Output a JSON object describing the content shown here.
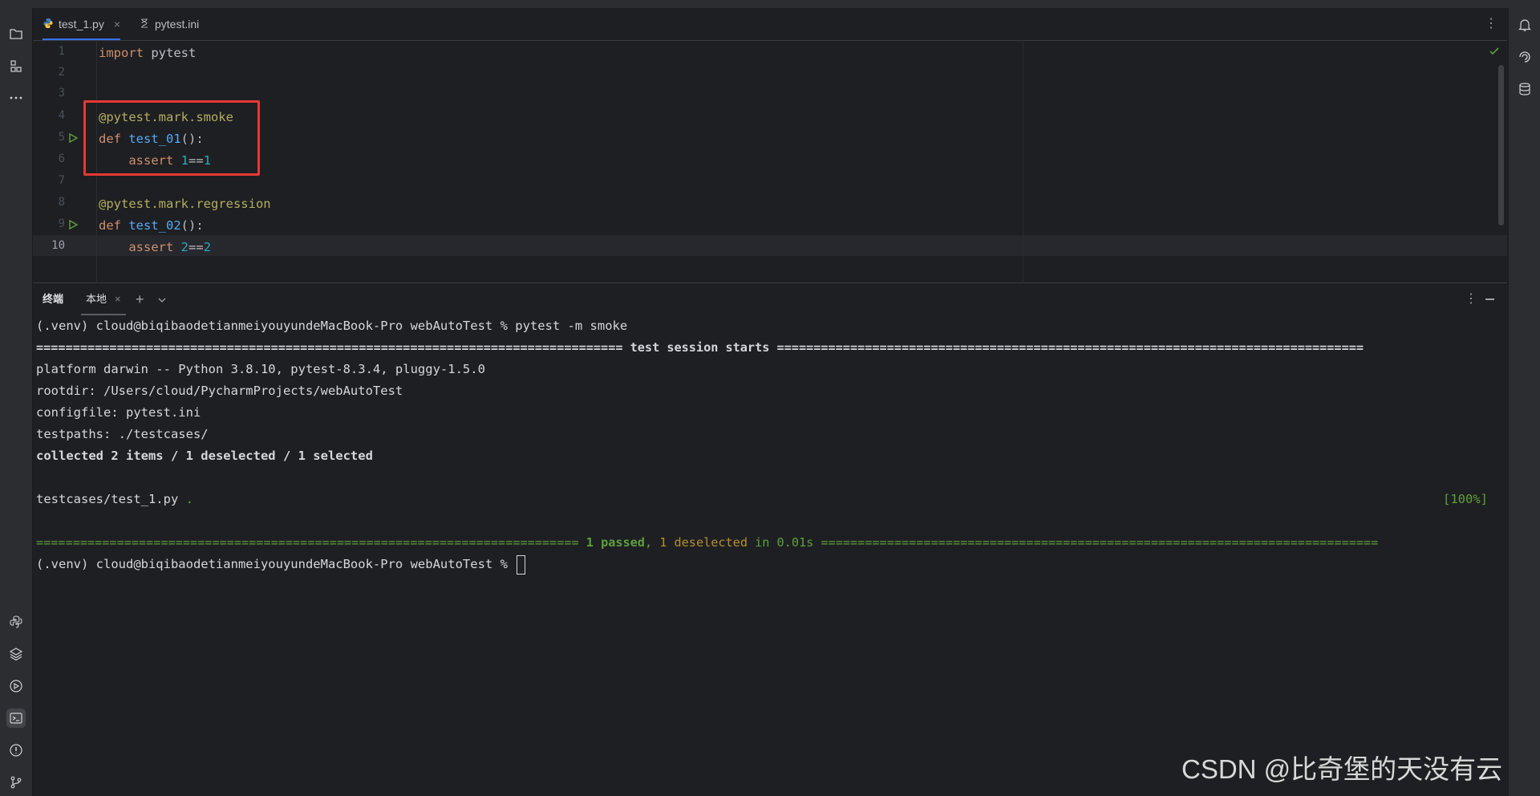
{
  "tabs": [
    {
      "name": "test_1.py",
      "active": true,
      "icon": "python-file-icon"
    },
    {
      "name": "pytest.ini",
      "active": false,
      "icon": "ini-file-icon"
    }
  ],
  "editor": {
    "line_numbers": [
      "1",
      "2",
      "3",
      "4",
      "5",
      "6",
      "7",
      "8",
      "9",
      "10"
    ],
    "current_line": "10",
    "lines": {
      "l1_kw": "import",
      "l1_mod": " pytest",
      "l4_dec": "@pytest.mark.smoke",
      "l5_kw": "def",
      "l5_fn": "test_01",
      "l5_rest": "():",
      "l6_kw": "assert",
      "l6_a": "1",
      "l6_op": "==",
      "l6_b": "1",
      "l8_dec": "@pytest.mark.regression",
      "l9_kw": "def",
      "l9_fn": "test_02",
      "l9_rest": "():",
      "l10_kw": "assert",
      "l10_a": "2",
      "l10_op": "==",
      "l10_b": "2"
    }
  },
  "terminal": {
    "tab_terminal": "终端",
    "tab_local": "本地",
    "prompt": "(.venv) cloud@biqibaodetianmeiyouyundeMacBook-Pro webAutoTest % ",
    "command": "pytest -m smoke",
    "session_line": "================================================================================ test session starts ================================================================================",
    "platform": "platform darwin -- Python 3.8.10, pytest-8.3.4, pluggy-1.5.0",
    "rootdir": "rootdir: /Users/cloud/PycharmProjects/webAutoTest",
    "configfile": "configfile: pytest.ini",
    "testpaths": "testpaths: ./testcases/",
    "collected": "collected 2 items / 1 deselected / 1 selected",
    "result_file": "testcases/test_1.py ",
    "result_dot": ".",
    "result_pct": "[100%]",
    "summary_eq_left": "========================================================================== ",
    "summary_passed": "1 passed",
    "summary_comma": ", ",
    "summary_deselected": "1 deselected",
    "summary_time": " in 0.01s",
    "summary_eq_right": " ============================================================================"
  },
  "watermark": "CSDN @比奇堡的天没有云",
  "colors": {
    "accent": "#3574f0",
    "highlight_box": "#e53935",
    "pass_green": "#5e9f3c",
    "deselect_yellow": "#b58f2f"
  }
}
